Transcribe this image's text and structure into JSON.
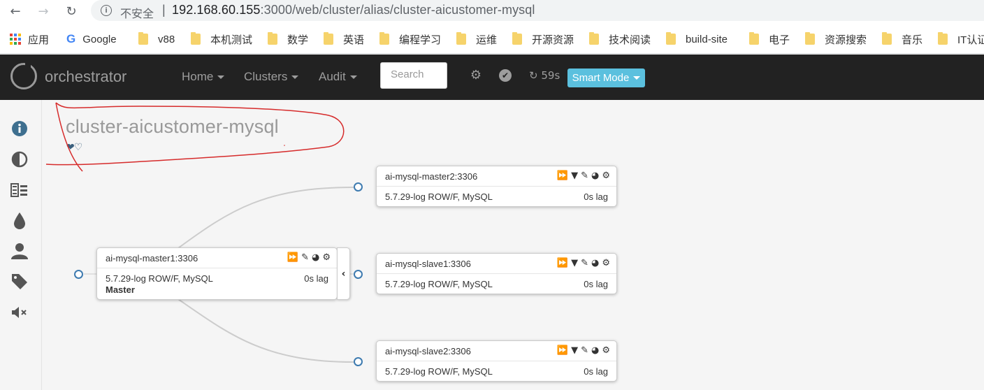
{
  "browser": {
    "back": "←",
    "forward": "→",
    "reload": "↻",
    "insecure_label": "不安全",
    "separator": "|",
    "url_host": "192.168.60.155",
    "url_rest": ":3000/web/cluster/alias/cluster-aicustomer-mysql"
  },
  "bookmarks": {
    "apps": "应用",
    "google": "Google",
    "items": [
      "v88",
      "本机测试",
      "数学",
      "英语",
      "编程学习",
      "运维",
      "开源资源",
      "技术阅读",
      "build-site",
      "电子",
      "资源搜索",
      "音乐",
      "IT认证"
    ]
  },
  "navbar": {
    "brand": "orchestrator",
    "home": "Home",
    "clusters": "Clusters",
    "audit": "Audit",
    "search_placeholder": "Search",
    "timer": "59s",
    "smart_mode": "Smart Mode"
  },
  "sidebar": {
    "icons": [
      "info-icon",
      "contrast-icon",
      "compare-icon",
      "tint-icon",
      "user-icon",
      "tag-icon",
      "volume-off-icon"
    ]
  },
  "cluster": {
    "title": "cluster-aicustomer-mysql",
    "hearts": "❤♡"
  },
  "instances": {
    "master1": {
      "name": "ai-mysql-master1:3306",
      "version": "5.7.29-log ROW/F, MySQL",
      "lag": "0s lag",
      "role": "Master"
    },
    "master2": {
      "name": "ai-mysql-master2:3306",
      "version": "5.7.29-log ROW/F, MySQL",
      "lag": "0s lag"
    },
    "slave1": {
      "name": "ai-mysql-slave1:3306",
      "version": "5.7.29-log ROW/F, MySQL",
      "lag": "0s lag"
    },
    "slave2": {
      "name": "ai-mysql-slave2:3306",
      "version": "5.7.29-log ROW/F, MySQL",
      "lag": "0s lag"
    }
  },
  "colors": {
    "navbar_bg": "#222222",
    "smart_mode_bg": "#5bc0de",
    "node_circle": "#3e7bb0",
    "annotation_red": "#d62b2b"
  }
}
